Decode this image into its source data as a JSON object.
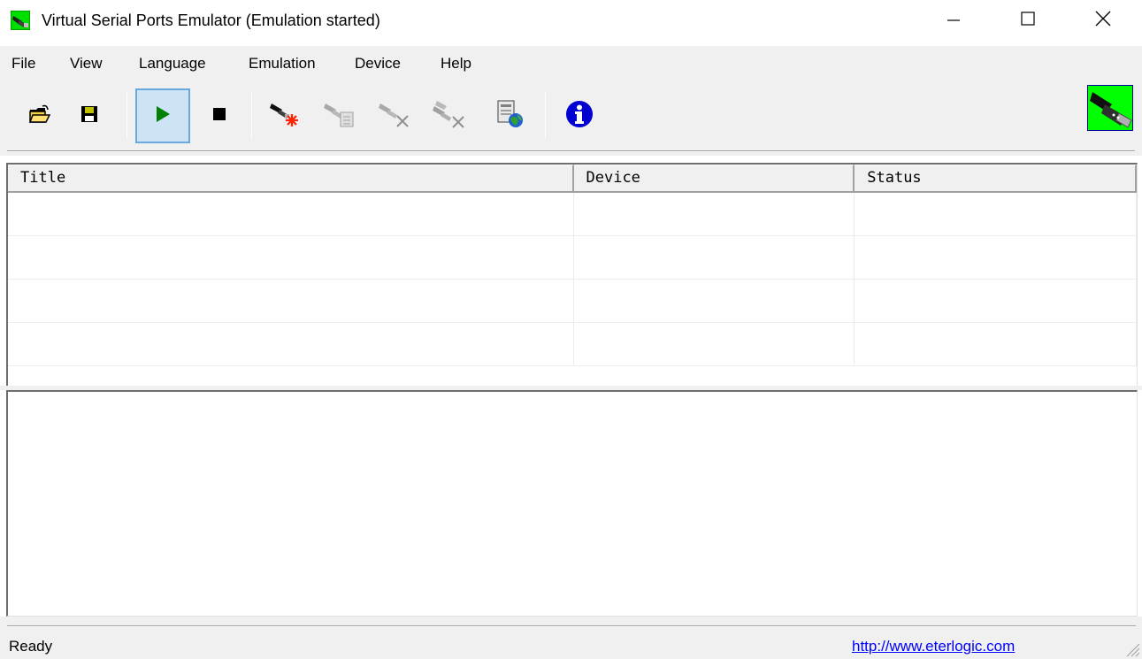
{
  "window": {
    "title": "Virtual Serial Ports Emulator (Emulation started)",
    "app_icon": "serial-port-icon",
    "controls": [
      "minimize-icon",
      "maximize-icon",
      "close-icon"
    ]
  },
  "menu": {
    "items": [
      {
        "label": "File"
      },
      {
        "label": "View"
      },
      {
        "label": "Language"
      },
      {
        "label": "Emulation"
      },
      {
        "label": "Device"
      },
      {
        "label": "Help"
      }
    ]
  },
  "toolbar": {
    "buttons": [
      {
        "icon": "open-folder-icon",
        "enabled": true
      },
      {
        "icon": "save-icon",
        "enabled": true
      },
      {
        "icon": "play-icon",
        "enabled": true,
        "pressed": true,
        "color": "#008000"
      },
      {
        "icon": "stop-icon",
        "enabled": true
      },
      {
        "icon": "new-device-icon",
        "enabled": true
      },
      {
        "icon": "device-properties-icon",
        "enabled": false
      },
      {
        "icon": "delete-device-icon",
        "enabled": false
      },
      {
        "icon": "delete-all-devices-icon",
        "enabled": false
      },
      {
        "icon": "network-settings-icon",
        "enabled": true
      },
      {
        "icon": "info-icon",
        "enabled": true,
        "color": "#0000d0"
      }
    ],
    "brand_icon": "serial-connector-logo-icon",
    "brand_color": "#00ff00"
  },
  "device_list": {
    "columns": [
      {
        "label": "Title"
      },
      {
        "label": "Device"
      },
      {
        "label": "Status"
      }
    ],
    "rows": []
  },
  "log": {
    "lines": []
  },
  "statusbar": {
    "text": "Ready",
    "link": "http://www.eterlogic.com",
    "link_color": "#0000ff"
  }
}
